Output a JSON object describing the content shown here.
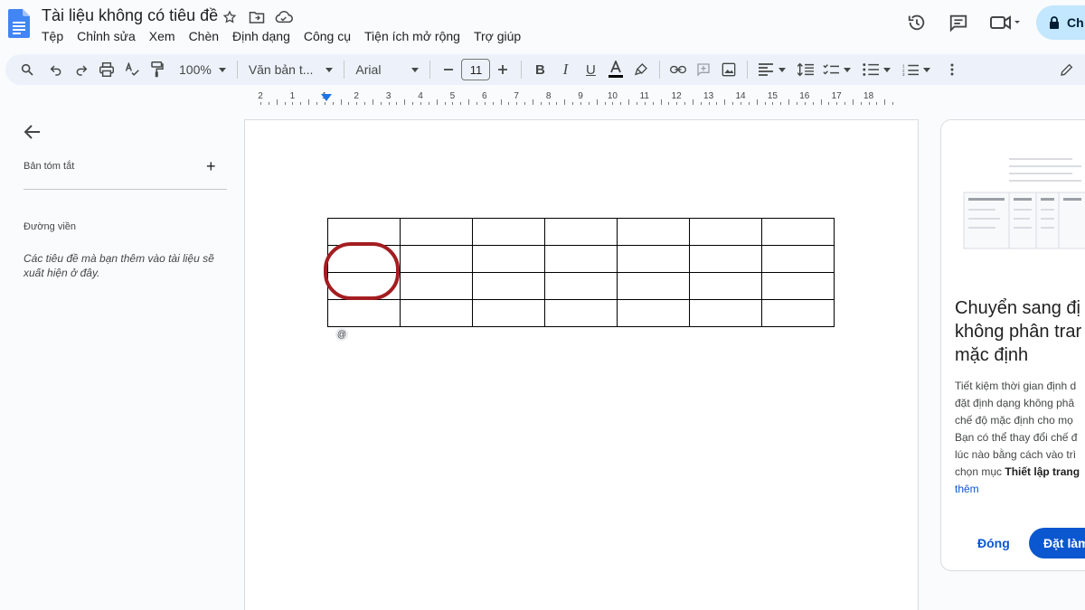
{
  "doc": {
    "title": "Tài liệu không có tiêu đề"
  },
  "menu": [
    "Tệp",
    "Chỉnh sửa",
    "Xem",
    "Chèn",
    "Định dạng",
    "Công cụ",
    "Tiện ích mở rộng",
    "Trợ giúp"
  ],
  "share": {
    "label": "Ch"
  },
  "toolbar": {
    "zoom": "100%",
    "style": "Văn bản t...",
    "font": "Arial",
    "font_size": "11"
  },
  "ruler": {
    "numbers": [
      "2",
      "1",
      "1",
      "2",
      "3",
      "4",
      "5",
      "6",
      "7",
      "8",
      "9",
      "10",
      "11",
      "12",
      "13",
      "14",
      "15",
      "16",
      "17",
      "18"
    ]
  },
  "sidebar": {
    "summary_label": "Bản tóm tắt",
    "outline_label": "Đường viền",
    "outline_hint": "Các tiêu đề mà bạn thêm vào tài liệu sẽ xuất hiện ở đây."
  },
  "table": {
    "rows": 4,
    "cols": 7
  },
  "page": {
    "at_chip": "@"
  },
  "panel": {
    "title_lines": [
      "Chuyển sang đị",
      "không phân trar",
      "mặc định"
    ],
    "body_lines": [
      "Tiết kiệm thời gian định d",
      "đặt định dạng không phâ",
      "chế độ mặc định cho mọ",
      "Bạn có thể thay đổi chế đ",
      "lúc nào bằng cách vào trì"
    ],
    "body_line6_prefix": "chọn mục ",
    "body_line6_bold": "Thiết lập trang",
    "body_link": "thêm",
    "close_label": "Đóng",
    "set_label": "Đặt làm"
  },
  "colors": {
    "accent": "#0b57d0",
    "toolbar_bg": "#edf2fa",
    "highlight_circle": "#a31d21"
  }
}
